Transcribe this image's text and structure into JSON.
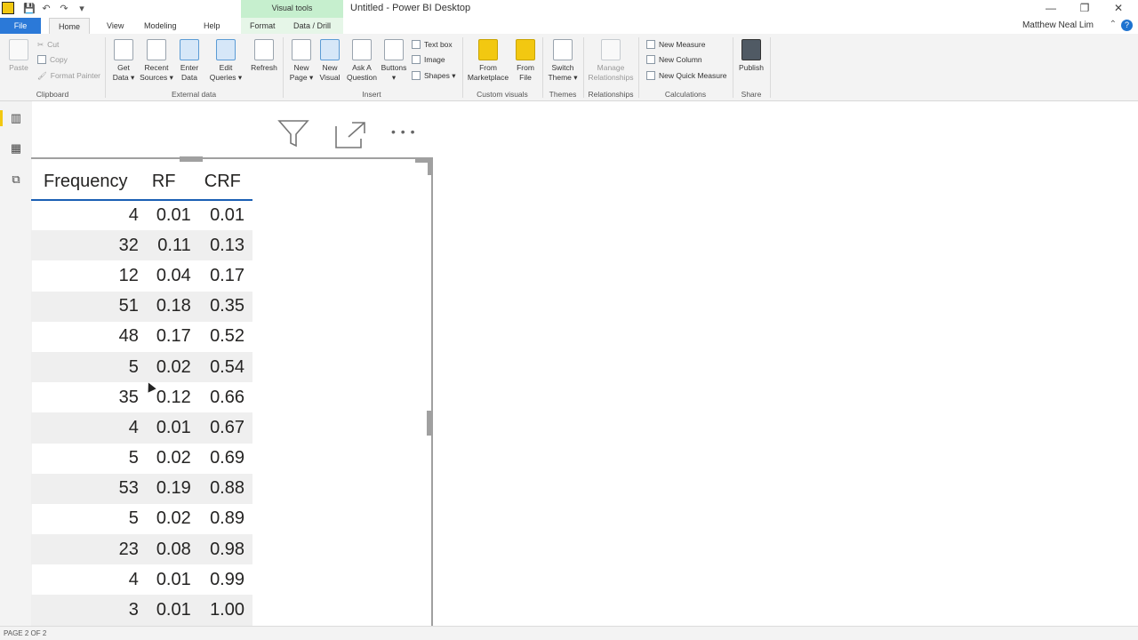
{
  "window": {
    "title": "Untitled - Power BI Desktop",
    "context_tab_group": "Visual tools",
    "minimize": "—",
    "restore": "❐",
    "close": "✕"
  },
  "qat": {
    "save": "💾",
    "undo": "↶",
    "redo": "↷",
    "more": "▾"
  },
  "tabs": [
    {
      "label": "File"
    },
    {
      "label": "Home"
    },
    {
      "label": "View"
    },
    {
      "label": "Modeling"
    },
    {
      "label": "Help"
    },
    {
      "label": "Format"
    },
    {
      "label": "Data / Drill"
    }
  ],
  "user": {
    "name": "Matthew Neal Lim",
    "help": "?"
  },
  "ribbon": {
    "clipboard": {
      "paste": "Paste",
      "cut": "Cut",
      "copy": "Copy",
      "format_painter": "Format Painter",
      "group": "Clipboard"
    },
    "external_data": {
      "get_data": "Get Data ▾",
      "recent_sources": "Recent Sources ▾",
      "enter_data": "Enter Data",
      "edit_queries": "Edit Queries ▾",
      "refresh": "Refresh",
      "group": "External data"
    },
    "insert": {
      "new_page": "New Page ▾",
      "new_visual": "New Visual",
      "ask_question": "Ask A Question",
      "buttons": "Buttons ▾",
      "text_box": "Text box",
      "image": "Image",
      "shapes": "Shapes ▾",
      "group": "Insert"
    },
    "custom_visuals": {
      "from_marketplace": "From Marketplace",
      "from_file": "From File",
      "group": "Custom visuals"
    },
    "themes": {
      "switch_theme": "Switch Theme ▾",
      "group": "Themes"
    },
    "relationships": {
      "manage": "Manage Relationships",
      "group": "Relationships"
    },
    "calculations": {
      "new_measure": "New Measure",
      "new_column": "New Column",
      "new_quick_measure": "New Quick Measure",
      "group": "Calculations"
    },
    "share": {
      "publish": "Publish",
      "group": "Share"
    }
  },
  "table": {
    "headers": [
      "Frequency",
      "RF",
      "CRF"
    ],
    "rows": [
      [
        "4",
        "0.01",
        "0.01"
      ],
      [
        "32",
        "0.11",
        "0.13"
      ],
      [
        "12",
        "0.04",
        "0.17"
      ],
      [
        "51",
        "0.18",
        "0.35"
      ],
      [
        "48",
        "0.17",
        "0.52"
      ],
      [
        "5",
        "0.02",
        "0.54"
      ],
      [
        "35",
        "0.12",
        "0.66"
      ],
      [
        "4",
        "0.01",
        "0.67"
      ],
      [
        "5",
        "0.02",
        "0.69"
      ],
      [
        "53",
        "0.19",
        "0.88"
      ],
      [
        "5",
        "0.02",
        "0.89"
      ],
      [
        "23",
        "0.08",
        "0.98"
      ],
      [
        "4",
        "0.01",
        "0.99"
      ],
      [
        "3",
        "0.01",
        "1.00"
      ]
    ]
  },
  "visual_header": {
    "more": "• • •"
  },
  "status": {
    "page": "PAGE 2 OF 2"
  },
  "colors": {
    "accent": "#f2c811",
    "file_tab": "#2b79d8",
    "header_underline": "#1a5fb4"
  }
}
